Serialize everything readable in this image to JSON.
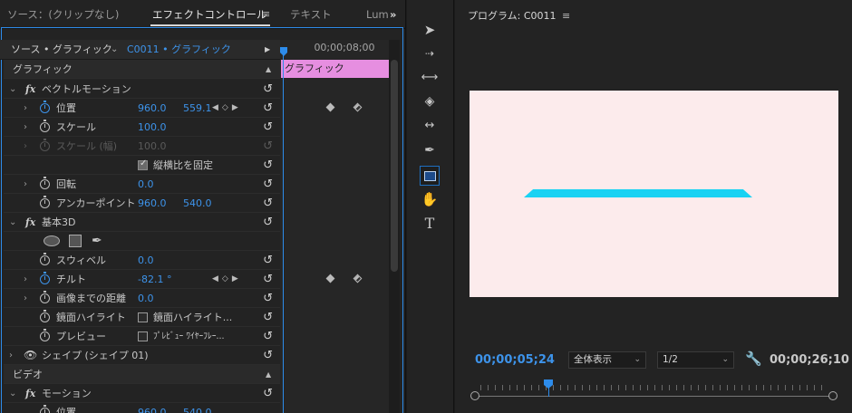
{
  "tabs": {
    "source": "ソース：(クリップなし)",
    "effect_controls": "エフェクトコントロール",
    "text": "テキスト",
    "lumetri": "Lum",
    "overflow": "»",
    "menu": "≡"
  },
  "source_row": {
    "master": "ソース • グラフィック",
    "clip": "C0011 • グラフィック",
    "timecode": "00;00;08;00",
    "clip_bar_label": "グラフィック"
  },
  "sections": {
    "graphic": "グラフィック",
    "vector_motion": "ベクトルモーション",
    "basic_3d": "基本3D",
    "shape": "シェイプ (シェイプ 01)",
    "video": "ビデオ",
    "motion": "モーション",
    "fx": "fx"
  },
  "vector_motion_props": {
    "position_label": "位置",
    "position_x": "960.0",
    "position_y": "559.1",
    "scale_label": "スケール",
    "scale_value": "100.0",
    "scale_width_label": "スケール (幅)",
    "scale_width_value": "100.0",
    "uniform_scale_label": "縦横比を固定",
    "rotation_label": "回転",
    "rotation_value": "0.0",
    "anchor_label": "アンカーポイント",
    "anchor_x": "960.0",
    "anchor_y": "540.0"
  },
  "basic3d_props": {
    "swivel_label": "スウィベル",
    "swivel_value": "0.0",
    "tilt_label": "チルト",
    "tilt_value": "-82.1 °",
    "distance_label": "画像までの距離",
    "distance_value": "0.0",
    "specular_label": "鏡面ハイライト",
    "specular_check": "鏡面ハイライト...",
    "preview_label": "プレビュー",
    "preview_check": "ﾌﾟﾚﾋﾞｭｰ ﾜｲﾔｰﾌﾚｰ..."
  },
  "motion_props": {
    "position_label": "位置",
    "position_x": "960.0",
    "position_y": "540.0"
  },
  "program": {
    "title": "プログラム: C0011",
    "menu": "≡",
    "current_tc": "00;00;05;24",
    "zoom": "全体表示",
    "resolution": "1/2",
    "duration_tc": "00;00;26;10"
  },
  "colors": {
    "accent": "#2d8ceb",
    "value_blue": "#3d93ea",
    "clip_pink": "#e68ee0",
    "frame_bg": "#fcebec",
    "shape_cyan": "#19d2f3"
  },
  "icons": {
    "reset": "↺",
    "chevron_right": "›",
    "chevron_down": "⌄",
    "triangle_up": "▲",
    "play_triangle": "▶"
  }
}
